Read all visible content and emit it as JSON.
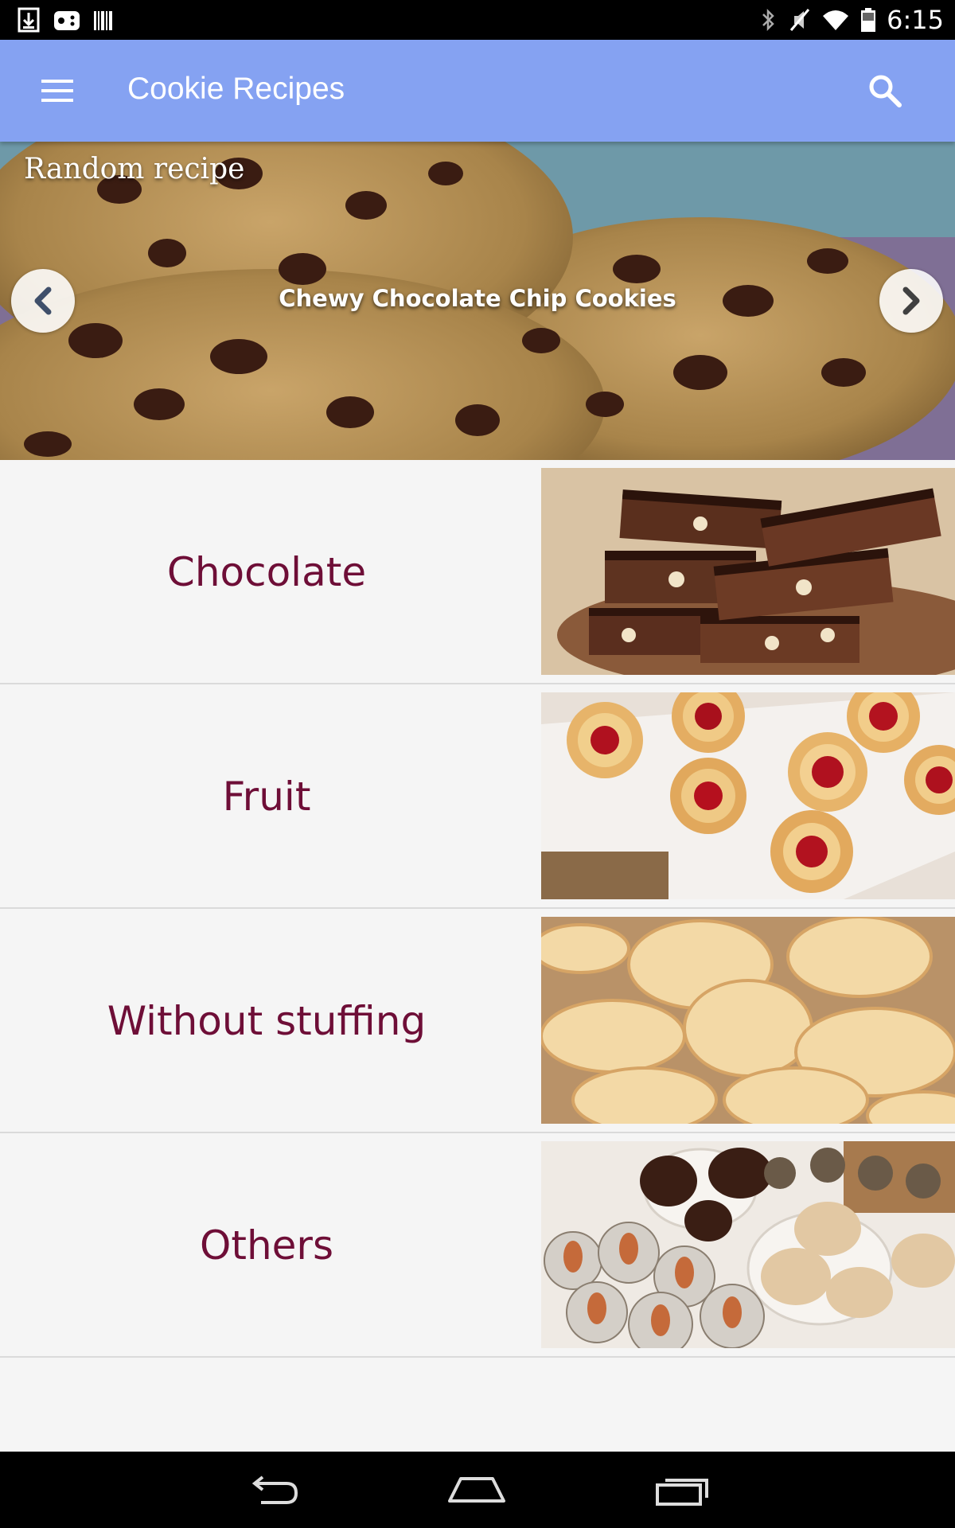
{
  "status_bar": {
    "time": "6:15",
    "left_icons": [
      "download-icon",
      "game-controller-icon",
      "barcode-icon"
    ],
    "right_icons": [
      "bluetooth-icon",
      "mute-icon",
      "wifi-icon",
      "battery-icon"
    ]
  },
  "app_bar": {
    "title": "Cookie Recipes",
    "menu_icon": "menu-icon",
    "search_icon": "search-icon",
    "color": "#85a2f2"
  },
  "hero": {
    "label": "Random recipe",
    "caption": "Chewy Chocolate Chip Cookies",
    "prev_icon": "chevron-left-icon",
    "next_icon": "chevron-right-icon"
  },
  "categories": [
    {
      "label": "Chocolate"
    },
    {
      "label": "Fruit"
    },
    {
      "label": "Without stuffing"
    },
    {
      "label": "Others"
    }
  ],
  "colors": {
    "category_text": "#6e0e37",
    "background": "#f5f5f5"
  },
  "nav_bar": {
    "icons": [
      "back-icon",
      "home-icon",
      "recent-apps-icon"
    ]
  }
}
